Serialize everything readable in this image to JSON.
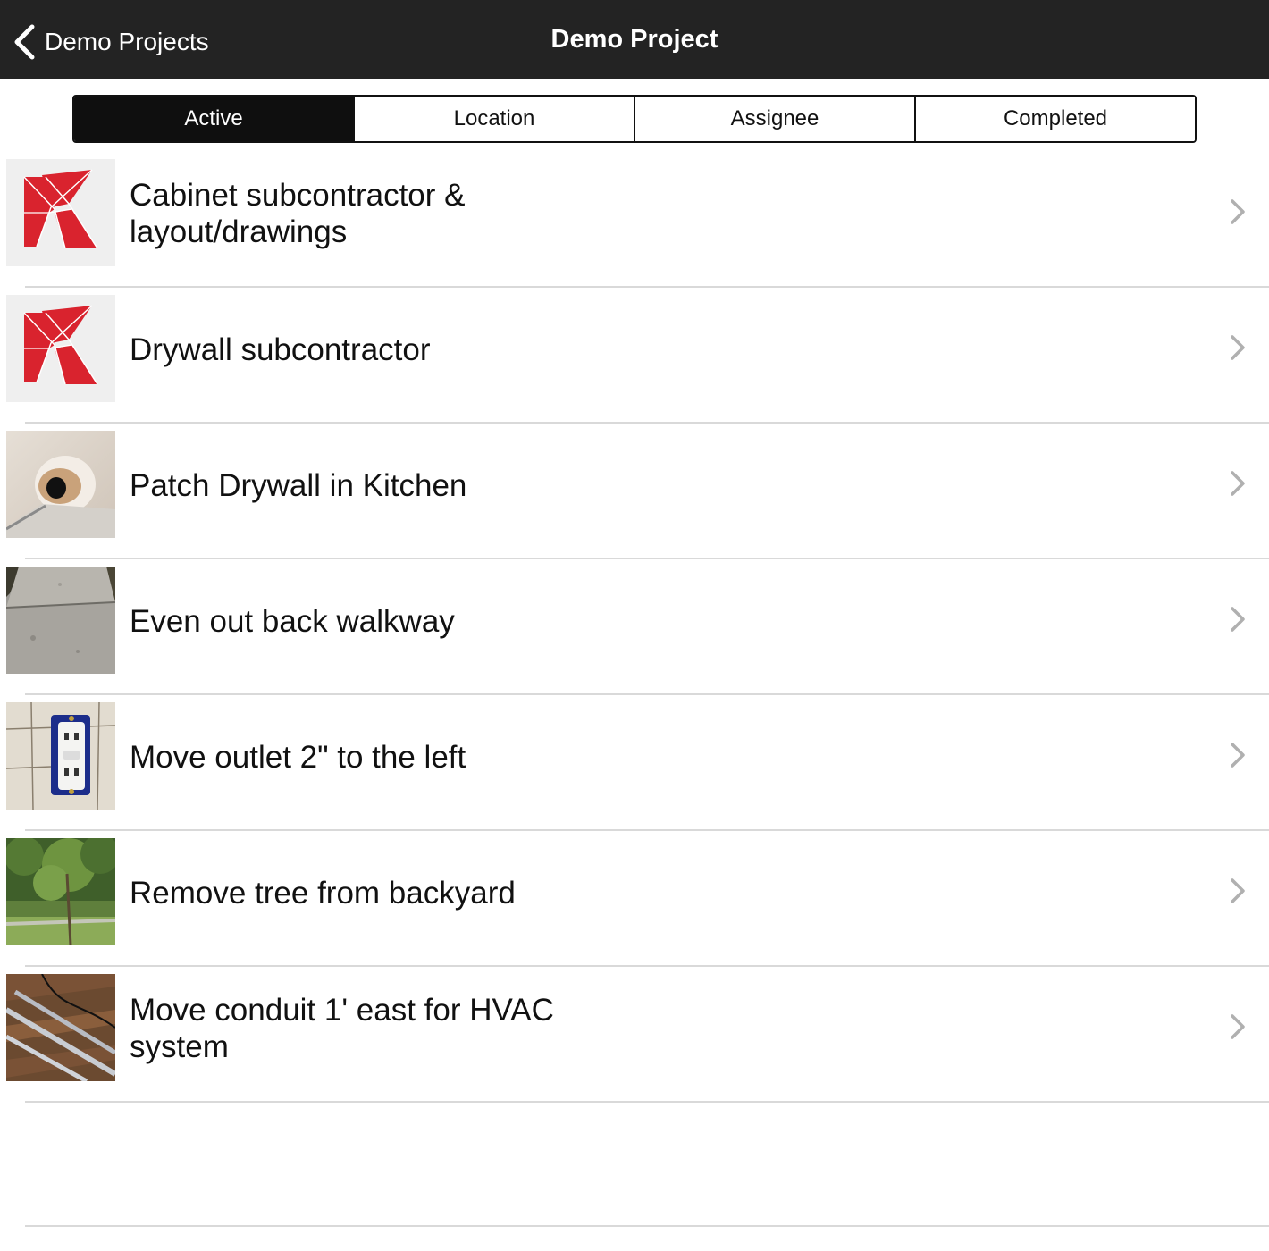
{
  "navbar": {
    "back_label": "Demo Projects",
    "title": "Demo Project",
    "background": "#232323"
  },
  "segments": [
    {
      "label": "Active",
      "selected": true
    },
    {
      "label": "Location",
      "selected": false
    },
    {
      "label": "Assignee",
      "selected": false
    },
    {
      "label": "Completed",
      "selected": false
    }
  ],
  "items": [
    {
      "label": "Cabinet subcontractor & layout/drawings",
      "thumbnail": "k-logo-icon"
    },
    {
      "label": "Drywall subcontractor",
      "thumbnail": "k-logo-icon"
    },
    {
      "label": "Patch Drywall in Kitchen",
      "thumbnail": "drywall-hole-photo"
    },
    {
      "label": "Even out back walkway",
      "thumbnail": "walkway-photo"
    },
    {
      "label": "Move outlet 2\" to the left",
      "thumbnail": "outlet-photo"
    },
    {
      "label": "Remove tree from backyard",
      "thumbnail": "tree-photo"
    },
    {
      "label": "Move conduit 1' east for HVAC system",
      "thumbnail": "conduit-photo"
    }
  ],
  "colors": {
    "brand_red": "#d9232e",
    "separator": "#d9d9d9",
    "chevron": "#b0b0b0"
  }
}
